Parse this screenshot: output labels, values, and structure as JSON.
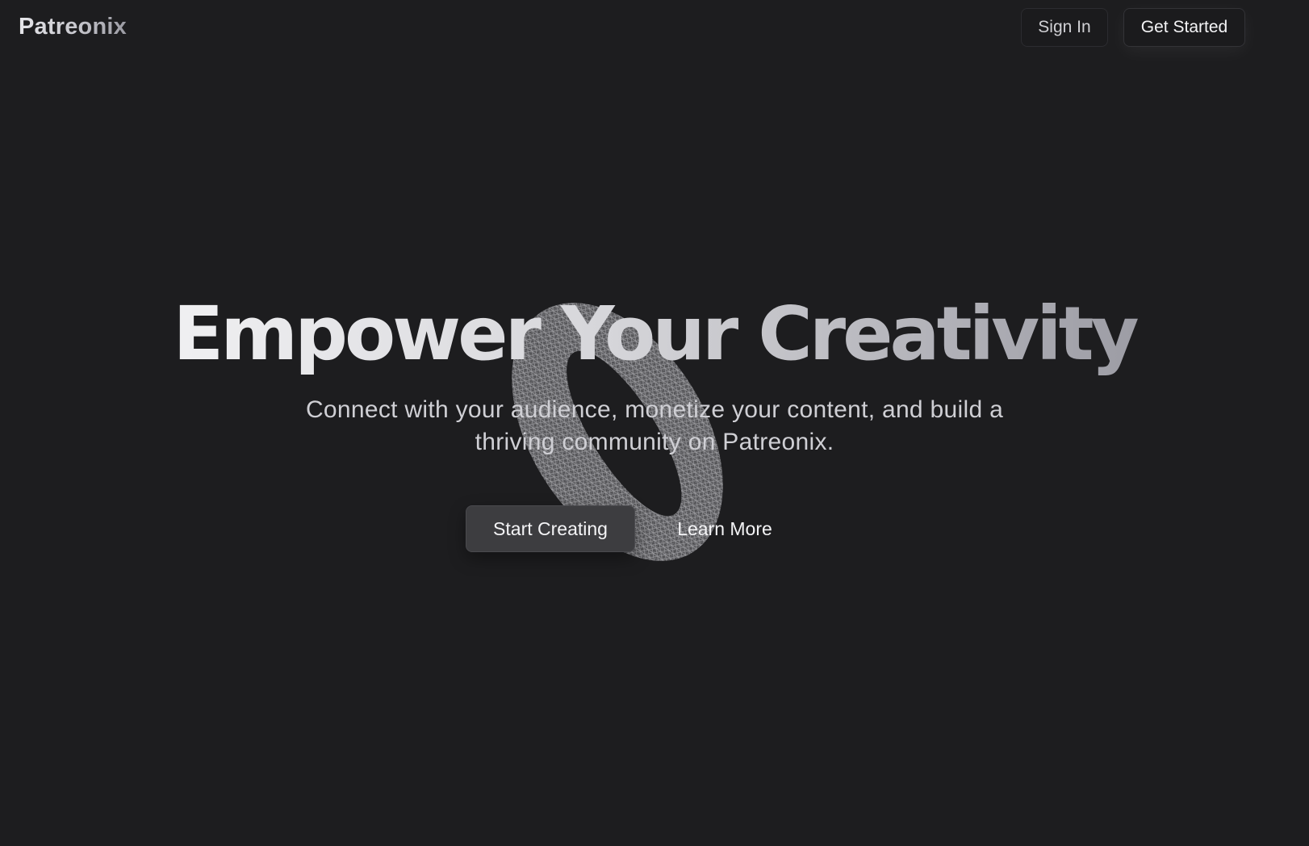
{
  "brand": {
    "name": "Patreonix"
  },
  "nav": {
    "sign_in": "Sign In",
    "get_started": "Get Started"
  },
  "hero": {
    "headline": "Empower Your Creativity",
    "subtitle": "Connect with your audience, monetize your content, and build a thriving community on Patreonix.",
    "primary_cta": "Start Creating",
    "secondary_cta": "Learn More",
    "graphic": "wireframe-torus-icon"
  },
  "colors": {
    "background": "#1d1d1f",
    "primary_button": "#3d3d40",
    "text": "#f4f4f6"
  }
}
